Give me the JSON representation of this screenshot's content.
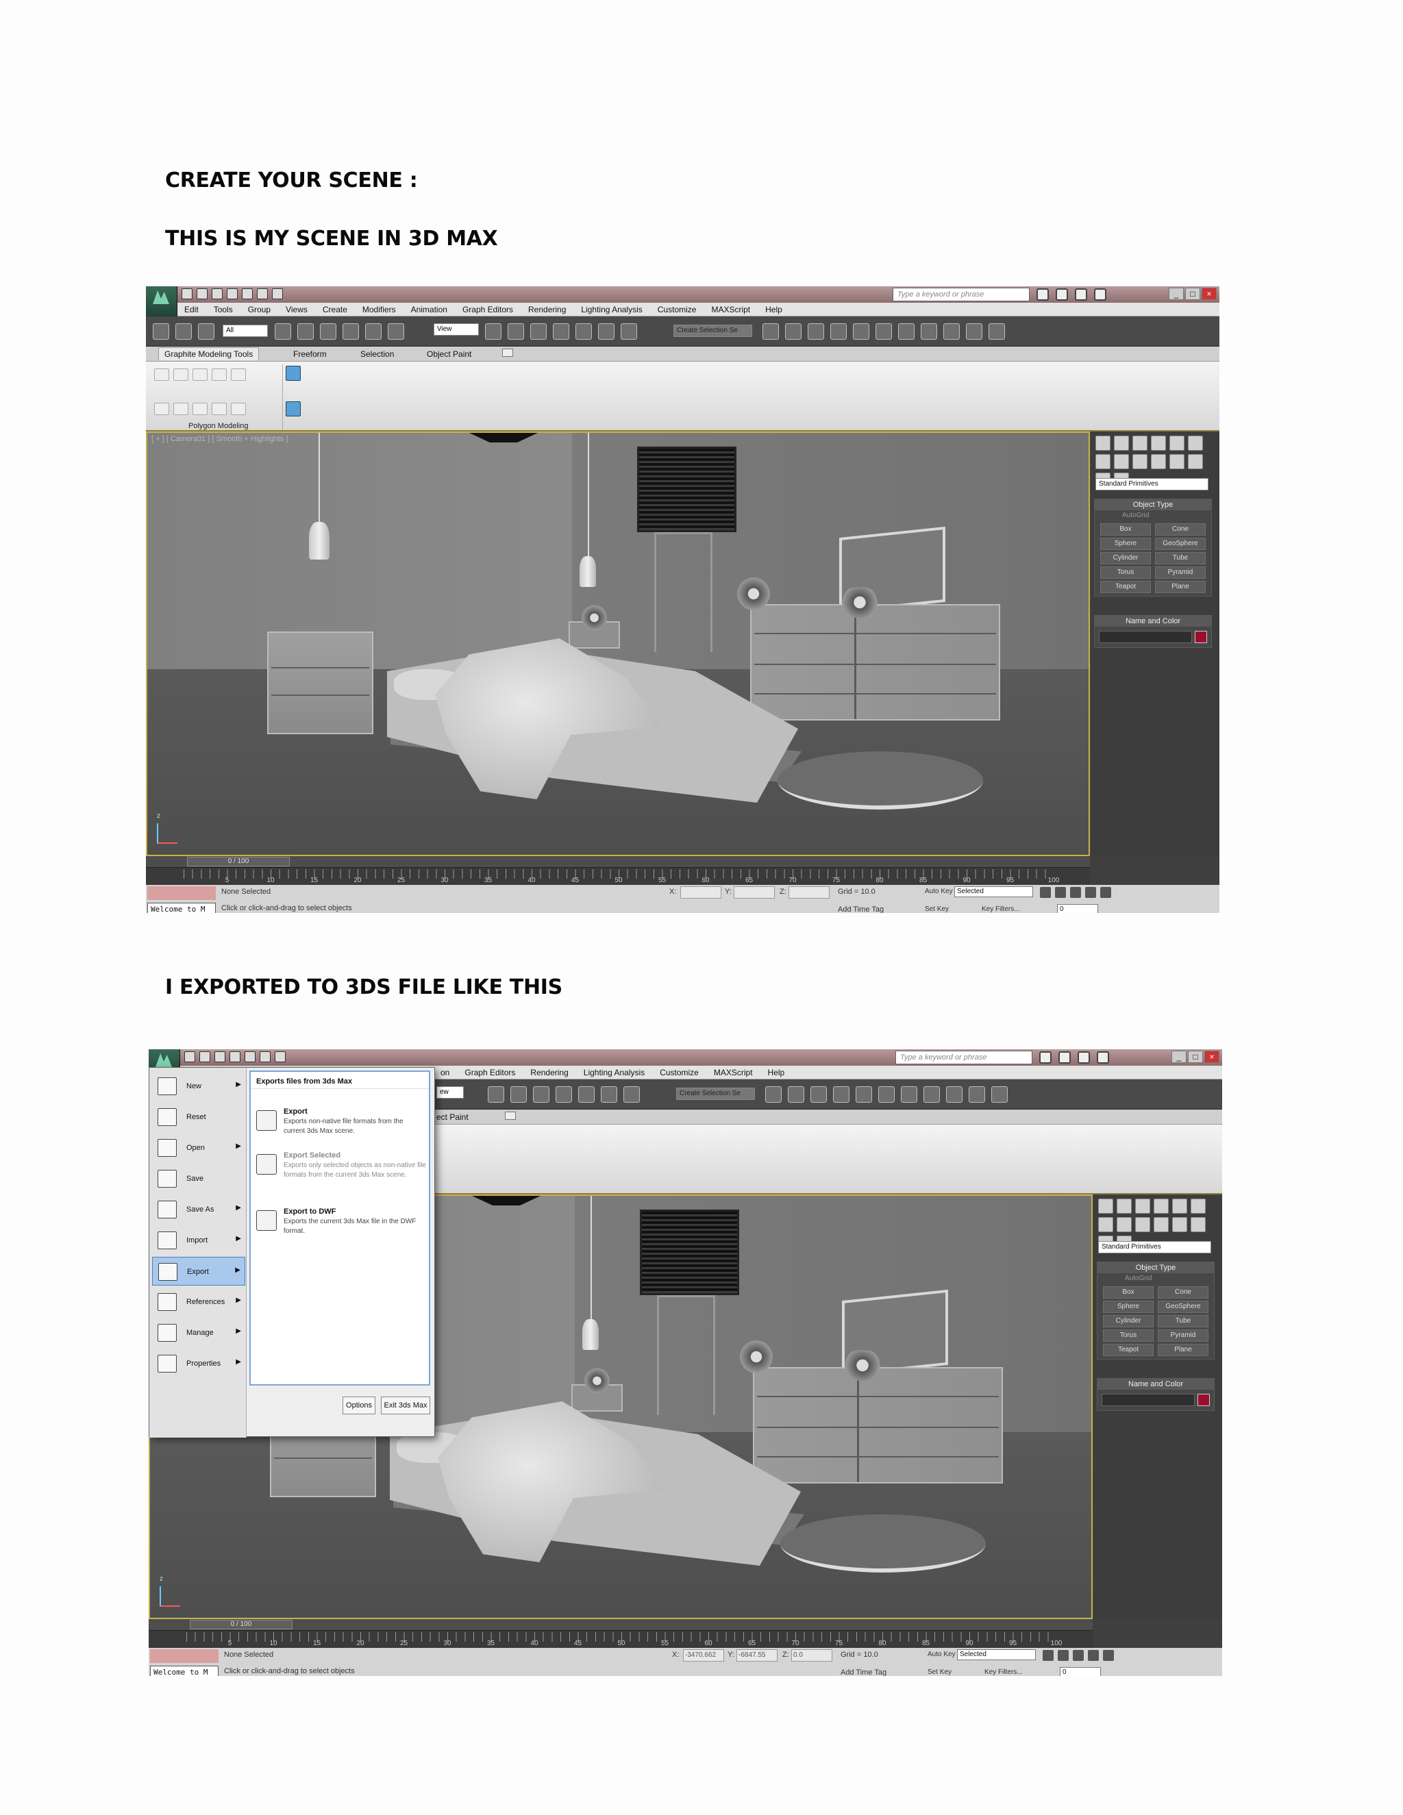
{
  "headings": {
    "create": "CREATE YOUR SCENE :",
    "scene": "THIS IS MY SCENE IN 3D MAX",
    "export": "I EXPORTED TO 3DS FILE LIKE THIS"
  },
  "app": {
    "search_placeholder": "Type a keyword or phrase",
    "menus": [
      "Edit",
      "Tools",
      "Group",
      "Views",
      "Create",
      "Modifiers",
      "Animation",
      "Graph Editors",
      "Rendering",
      "Lighting Analysis",
      "Customize",
      "MAXScript",
      "Help"
    ],
    "selection_filter": "All",
    "ref_coord": "View",
    "named_selection": "Create Selection Se",
    "ribbon_tabs": [
      "Graphite Modeling Tools",
      "Freeform",
      "Selection",
      "Object Paint"
    ],
    "ribbon_group": "Polygon Modeling",
    "viewport_label": "[ + ] [ Camera01 ] [ Smooth + Highlights ]",
    "primitives_dropdown": "Standard Primitives",
    "object_type_title": "Object Type",
    "autogrid": "AutoGrid",
    "primitives": [
      "Box",
      "Cone",
      "Sphere",
      "GeoSphere",
      "Cylinder",
      "Tube",
      "Torus",
      "Pyramid",
      "Teapot",
      "Plane"
    ],
    "name_color_title": "Name and Color",
    "time_slider": "0 / 100",
    "ruler_numbers": [
      "5",
      "10",
      "15",
      "20",
      "25",
      "30",
      "35",
      "40",
      "45",
      "50",
      "55",
      "60",
      "65",
      "70",
      "75",
      "80",
      "85",
      "90",
      "95",
      "100"
    ],
    "status_selected": "None Selected",
    "status_prompt": "Click or click-and-drag to select objects",
    "welcome": "Welcome to M",
    "x_label": "X:",
    "y_label": "Y:",
    "z_label": "Z:",
    "grid": "Grid = 10.0",
    "add_time_tag": "Add Time Tag",
    "auto_key": "Auto Key",
    "set_key": "Set Key",
    "selected": "Selected",
    "key_filters": "Key Filters...",
    "frame": "0",
    "coords2": {
      "x": "-3470.662",
      "y": "-6847.55",
      "z": "0.0"
    },
    "menus2": [
      "on",
      "Graph Editors",
      "Rendering",
      "Lighting Analysis",
      "Customize",
      "MAXScript",
      "Help"
    ],
    "ribbon_tab2": "ect Paint",
    "ref_coord2": "ew"
  },
  "app_menu": {
    "items": [
      {
        "label": "New",
        "arrow": true
      },
      {
        "label": "Reset",
        "arrow": false
      },
      {
        "label": "Open",
        "arrow": true
      },
      {
        "label": "Save",
        "arrow": false
      },
      {
        "label": "Save As",
        "arrow": true
      },
      {
        "label": "Import",
        "arrow": true
      },
      {
        "label": "Export",
        "arrow": true
      },
      {
        "label": "References",
        "arrow": true
      },
      {
        "label": "Manage",
        "arrow": true
      },
      {
        "label": "Properties",
        "arrow": true
      }
    ],
    "panel_title": "Exports files from 3ds Max",
    "entries": [
      {
        "title": "Export",
        "desc": "Exports non-native file formats from the current 3ds Max scene."
      },
      {
        "title": "Export Selected",
        "desc": "Exports only selected objects as non-native file formats from the current 3ds Max scene."
      },
      {
        "title": "Export to DWF",
        "desc": "Exports the current 3ds Max file in the DWF format."
      }
    ],
    "options": "Options",
    "exit": "Exit 3ds Max"
  }
}
